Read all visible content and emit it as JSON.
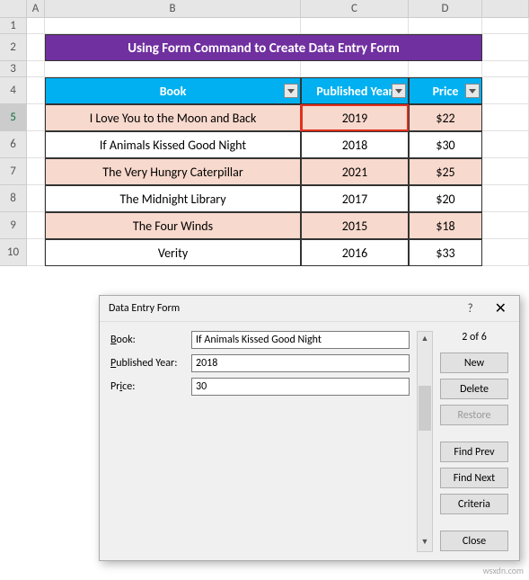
{
  "columns": [
    "",
    "A",
    "B",
    "C",
    "D",
    ""
  ],
  "rows": [
    "1",
    "2",
    "3",
    "4",
    "5",
    "6",
    "7",
    "8",
    "9",
    "10"
  ],
  "title": "Using Form Command to Create Data Entry Form",
  "headers": {
    "book": "Book",
    "year": "Published Year",
    "price": "Price"
  },
  "data": [
    {
      "book": "I Love You to the Moon and Back",
      "year": "2019",
      "price": "$22"
    },
    {
      "book": "If Animals Kissed Good Night",
      "year": "2018",
      "price": "$30"
    },
    {
      "book": "The Very Hungry Caterpillar",
      "year": "2021",
      "price": "$25"
    },
    {
      "book": "The Midnight Library",
      "year": "2017",
      "price": "$20"
    },
    {
      "book": "The Four Winds",
      "year": "2015",
      "price": "$18"
    },
    {
      "book": "Verity",
      "year": "2016",
      "price": "$33"
    }
  ],
  "dialog": {
    "title": "Data Entry Form",
    "labels": {
      "book": "Book:",
      "year": "Published Year:",
      "price": "Price:"
    },
    "values": {
      "book": "If Animals Kissed Good Night",
      "year": "2018",
      "price": "30"
    },
    "record": "2 of 6",
    "buttons": {
      "new": "New",
      "delete": "Delete",
      "restore": "Restore",
      "findprev": "Find Prev",
      "findnext": "Find Next",
      "criteria": "Criteria",
      "close": "Close"
    }
  },
  "watermark": "wsxdn.com"
}
